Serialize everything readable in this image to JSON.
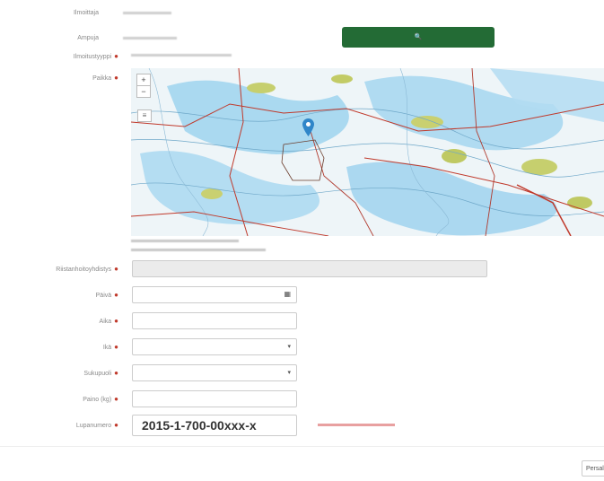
{
  "form": {
    "sender_label": "Ilmoittaja",
    "sender_value": "",
    "hunter_label": "Ampuja",
    "hunter_value": "",
    "notification_type_label": "Ilmoitustyyppi",
    "notification_type_value": "",
    "location_label": "Paikka",
    "coordinates_text": "",
    "property_text": "",
    "hunting_club_label": "Riistanhoitoyhdistys",
    "hunting_club_value": "",
    "date_label": "Päivä",
    "date_value": "",
    "time_label": "Aika",
    "time_value": "",
    "age_label": "Ikä",
    "age_value": "",
    "gender_label": "Sukupuoli",
    "gender_value": "",
    "weight_label": "Paino (kg)",
    "weight_value": "",
    "permit_label": "Lupanumero",
    "permit_value": "2015-1-700-00xxx-x",
    "permit_error": ""
  },
  "buttons": {
    "search_label": "",
    "save_label": "Persal"
  },
  "map": {
    "zoom_in": "+",
    "zoom_out": "−"
  },
  "colors": {
    "search_button": "#236b35",
    "required": "#c0392b",
    "error": "#d94b4b"
  }
}
